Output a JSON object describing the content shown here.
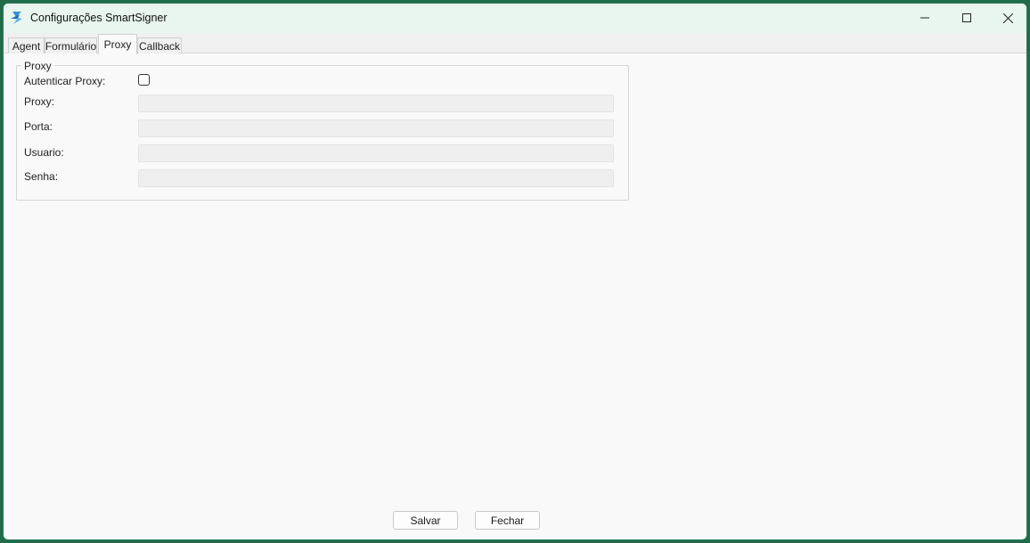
{
  "window": {
    "title": "Configurações SmartSigner"
  },
  "tabs": [
    {
      "label": "Agent"
    },
    {
      "label": "Formulário"
    },
    {
      "label": "Proxy"
    },
    {
      "label": "Callback"
    }
  ],
  "active_tab": "Proxy",
  "proxy_group": {
    "legend": "Proxy",
    "auth_label": "Autenticar Proxy:",
    "auth_checked": false,
    "fields": [
      {
        "label": "Proxy:",
        "value": ""
      },
      {
        "label": "Porta:",
        "value": ""
      },
      {
        "label": "Usuario:",
        "value": ""
      },
      {
        "label": "Senha:",
        "value": ""
      }
    ]
  },
  "buttons": {
    "save_label": "Salvar",
    "close_label": "Fechar"
  },
  "colors": {
    "titlebar": "#e9f6ef",
    "window_border": "#2d7a56",
    "background": "#f9f9f9"
  }
}
